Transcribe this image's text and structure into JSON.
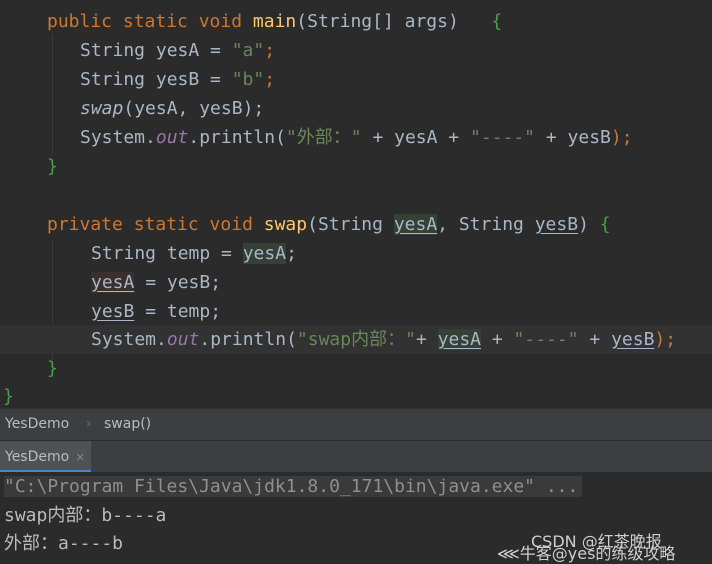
{
  "code": {
    "l1": {
      "kw": "public static void ",
      "fn": "main",
      "rest": "(String[] args)   ",
      "brace": "{"
    },
    "l2": {
      "text": "String yesA = ",
      "str": "\"a\"",
      "semi": ";"
    },
    "l3": {
      "text": "String yesB = ",
      "str": "\"b\"",
      "semi": ";"
    },
    "l4": {
      "call": "swap",
      "rest": "(yesA, yesB);"
    },
    "l5": {
      "pre": "System.",
      "field": "out",
      "mid": ".println(",
      "s1": "\"外部：\"",
      "p1": " + yesA + ",
      "s2": "\"----\"",
      "p2": " + yesB",
      "end": ");"
    },
    "l6": {
      "brace": "}"
    },
    "l8": {
      "kw": "private static void ",
      "fn": "swap",
      "open": "(String ",
      "a": "yesA",
      "comma": ", String ",
      "b": "yesB",
      "close": ") ",
      "brace": "{"
    },
    "l9": {
      "text": "String temp = ",
      "ref": "yesA",
      "semi": ";"
    },
    "l10": {
      "a": "yesA",
      "rest": " = yesB;"
    },
    "l11": {
      "b": "yesB",
      "rest": " = temp;"
    },
    "l12": {
      "pre": "System.",
      "field": "out",
      "mid": ".println(",
      "s1": "\"swap内部：\"",
      "plus1": "+ ",
      "a": "yesA",
      "plus2": " + ",
      "s2": "\"----\"",
      "plus3": " + ",
      "b": "yesB",
      "end": ");"
    },
    "l13": {
      "brace": "}"
    },
    "l14": {
      "brace": "}"
    }
  },
  "breadcrumb": {
    "items": [
      "YesDemo",
      "swap()"
    ],
    "sep": "›"
  },
  "run": {
    "tab_label": "YesDemo",
    "close": "×"
  },
  "console": {
    "lines": [
      "\"C:\\Program Files\\Java\\jdk1.8.0_171\\bin\\java.exe\" ...",
      "swap内部：b----a",
      "外部：a----b"
    ]
  },
  "watermark": {
    "line1": "CSDN @红茶晚报",
    "line2": "牛客@yes的练级攻略"
  },
  "colors": {
    "keyword": "#cc7832",
    "method": "#ffc66d",
    "string": "#6a8759",
    "field": "#9876aa",
    "text": "#a9b7c6",
    "background": "#2b2b2b",
    "brace_green": "#4a9f48"
  }
}
